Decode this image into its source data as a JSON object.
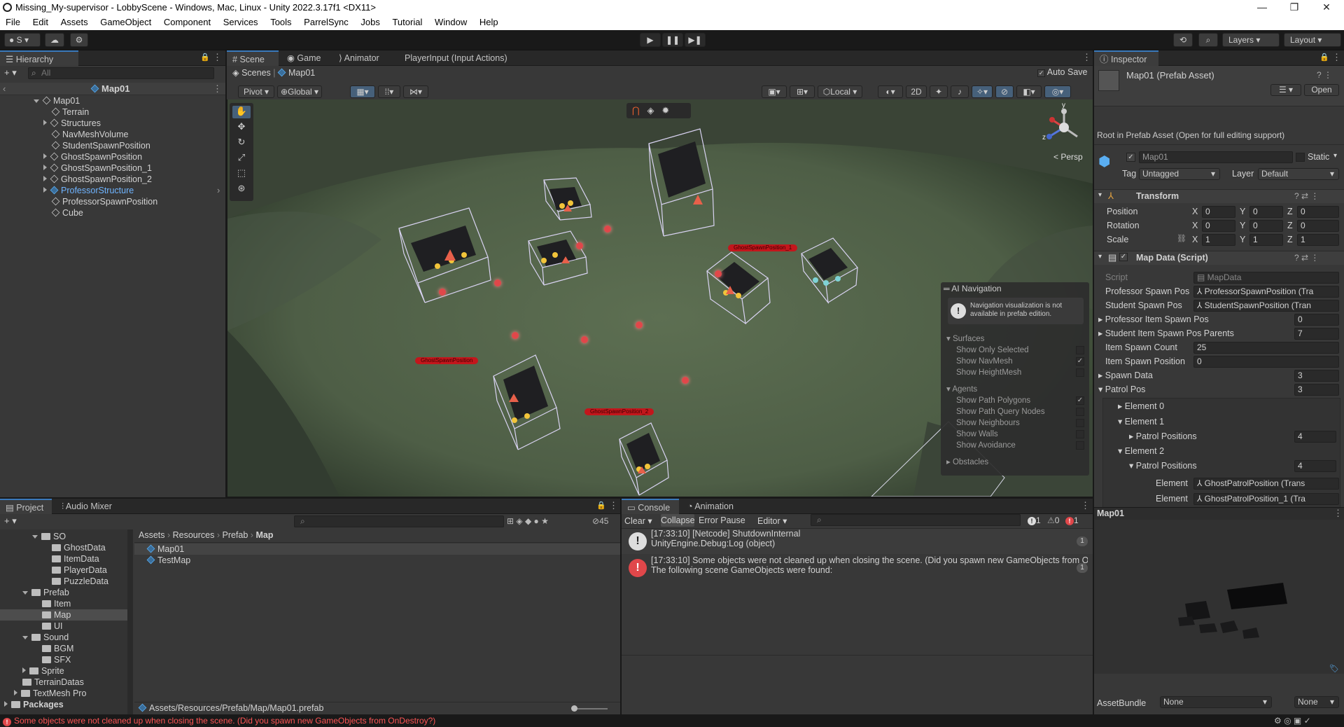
{
  "window": {
    "title": "Missing_My-supervisor - LobbyScene - Windows, Mac, Linux - Unity 2022.3.17f1 <DX11>",
    "controls": [
      "—",
      "❐",
      "✕"
    ]
  },
  "menu": [
    "File",
    "Edit",
    "Assets",
    "GameObject",
    "Component",
    "Services",
    "Tools",
    "ParrelSync",
    "Jobs",
    "Tutorial",
    "Window",
    "Help"
  ],
  "toolbar": {
    "account": "S",
    "layers": "Layers",
    "layout": "Layout"
  },
  "hierarchy": {
    "tab": "Hierarchy",
    "search_placeholder": "All",
    "root": "Map01",
    "items": [
      "Map01",
      "Terrain",
      "Structures",
      "NavMeshVolume",
      "StudentSpawnPosition",
      "GhostSpawnPosition",
      "GhostSpawnPosition_1",
      "GhostSpawnPosition_2",
      "ProfessorStructure",
      "ProfessorSpawnPosition",
      "Cube"
    ]
  },
  "scene": {
    "tabs": [
      "Scene",
      "Game",
      "Animator",
      "PlayerInput (Input Actions)"
    ],
    "breadcrumb": [
      "Scenes",
      "Map01"
    ],
    "auto_save": "Auto Save",
    "pivot": "Pivot",
    "global": "Global",
    "local": "Local",
    "mode_2d": "2D",
    "persp": "< Persp",
    "axis_y": "y",
    "axis_z": "z",
    "ghost_labels": [
      "GhostSpawnPosition_1",
      "GhostSpawnPosition",
      "GhostSpawnPosition_2"
    ]
  },
  "ai_nav": {
    "title": "AI Navigation",
    "notice": "Navigation visualization is not available in prefab edition.",
    "surfaces": "Surfaces",
    "surface_items": [
      "Show Only Selected",
      "Show NavMesh",
      "Show HeightMesh"
    ],
    "agents": "Agents",
    "agent_items": [
      "Show Path Polygons",
      "Show Path Query Nodes",
      "Show Neighbours",
      "Show Walls",
      "Show Avoidance"
    ],
    "obstacles": "Obstacles"
  },
  "inspector": {
    "tab": "Inspector",
    "asset_name": "Map01 (Prefab Asset)",
    "open_button": "Open",
    "root_notice": "Root in Prefab Asset (Open for full editing support)",
    "object_name": "Map01",
    "static_label": "Static",
    "tag_label": "Tag",
    "tag_value": "Untagged",
    "layer_label": "Layer",
    "layer_value": "Default",
    "transform": {
      "title": "Transform",
      "rows": [
        {
          "label": "Position",
          "x": "0",
          "y": "0",
          "z": "0"
        },
        {
          "label": "Rotation",
          "x": "0",
          "y": "0",
          "z": "0"
        },
        {
          "label": "Scale",
          "x": "1",
          "y": "1",
          "z": "1"
        }
      ]
    },
    "map_data": {
      "title": "Map Data (Script)",
      "script_label": "Script",
      "script_value": "MapData",
      "professor_spawn_label": "Professor Spawn Pos",
      "professor_spawn_value": "ProfessorSpawnPosition (Tra",
      "student_spawn_label": "Student Spawn Pos",
      "student_spawn_value": "StudentSpawnPosition (Tran",
      "professor_item_label": "Professor Item Spawn Pos",
      "professor_item_value": "0",
      "student_item_label": "Student Item Spawn Pos Parents",
      "student_item_value": "7",
      "item_count_label": "Item Spawn Count",
      "item_count_value": "25",
      "item_position_label": "Item Spawn Position",
      "item_position_value": "0",
      "spawn_data_label": "Spawn Data",
      "spawn_data_value": "3",
      "patrol_pos_label": "Patrol Pos",
      "patrol_pos_value": "3",
      "element0": "Element 0",
      "element1": "Element 1",
      "patrol_positions_label": "Patrol Positions",
      "patrol_positions_1": "4",
      "element2": "Element 2",
      "patrol_positions_2": "4",
      "element_label": "Element",
      "element_a": "GhostPatrolPosition (Trans",
      "element_b": "GhostPatrolPosition_1 (Tra"
    },
    "preview_title": "Map01",
    "assetbundle_label": "AssetBundle",
    "assetbundle_value": "None",
    "assetbundle_variant": "None"
  },
  "project": {
    "tabs": [
      "Project",
      "Audio Mixer"
    ],
    "hidden_count": "45",
    "tree": [
      {
        "label": "SO",
        "indent": 0,
        "open": true
      },
      {
        "label": "GhostData",
        "indent": 1
      },
      {
        "label": "ItemData",
        "indent": 1
      },
      {
        "label": "PlayerData",
        "indent": 1
      },
      {
        "label": "PuzzleData",
        "indent": 1
      },
      {
        "label": "Prefab",
        "indent": 0,
        "open": true
      },
      {
        "label": "Item",
        "indent": 1
      },
      {
        "label": "Map",
        "indent": 1,
        "selected": true
      },
      {
        "label": "UI",
        "indent": 1
      },
      {
        "label": "Sound",
        "indent": 0,
        "open": true
      },
      {
        "label": "BGM",
        "indent": 1
      },
      {
        "label": "SFX",
        "indent": 1
      },
      {
        "label": "Sprite",
        "indent": 0
      },
      {
        "label": "TerrainDatas",
        "indent": -1
      },
      {
        "label": "TextMesh Pro",
        "indent": -1
      },
      {
        "label": "Packages",
        "indent": -2
      }
    ],
    "breadcrumb": [
      "Assets",
      "Resources",
      "Prefab",
      "Map"
    ],
    "files": [
      "Map01",
      "TestMap"
    ],
    "path": "Assets/Resources/Prefab/Map/Map01.prefab"
  },
  "console": {
    "tabs": [
      "Console",
      "Animation"
    ],
    "clear": "Clear",
    "collapse": "Collapse",
    "error_pause": "Error Pause",
    "editor": "Editor",
    "counts": {
      "info": "1",
      "warn": "0",
      "error": "1"
    },
    "messages": [
      {
        "type": "info",
        "line1": "[17:33:10] [Netcode] ShutdownInternal",
        "line2": "UnityEngine.Debug:Log (object)",
        "count": "1"
      },
      {
        "type": "error",
        "line1": "[17:33:10] Some objects were not cleaned up when closing the scene. (Did you spawn new GameObjects from On",
        "line2": "The following scene GameObjects were found:",
        "count": "1"
      }
    ]
  },
  "status": "Some objects were not cleaned up when closing the scene. (Did you spawn new GameObjects from OnDestroy?)",
  "colors": {
    "accent": "#3a79bb",
    "error": "#e0474a",
    "selection": "#2c5d87"
  }
}
